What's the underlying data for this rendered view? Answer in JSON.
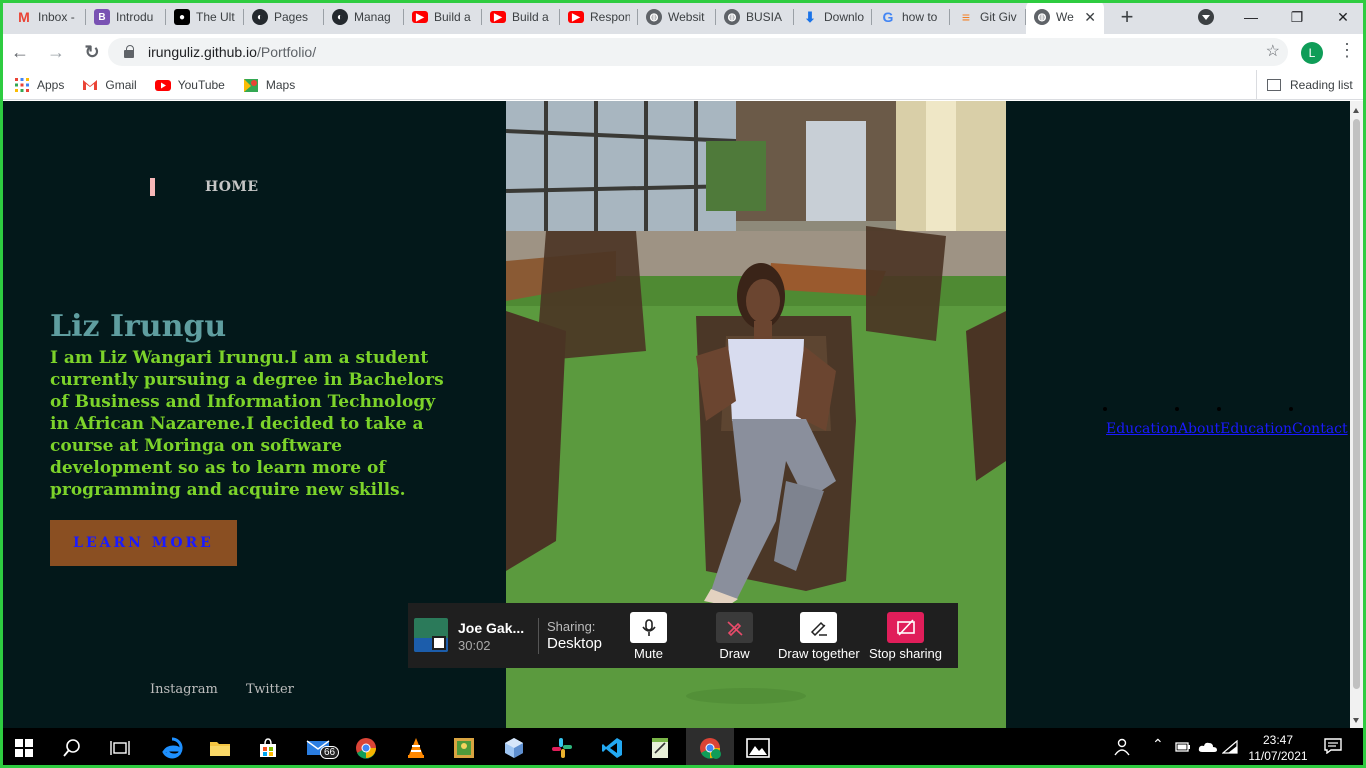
{
  "browser": {
    "tabs": [
      {
        "title": "Inbox -",
        "icon": "gmail-icon",
        "color": "#ea4335"
      },
      {
        "title": "Introdu",
        "icon": "bootstrap-icon",
        "color": "#7952b3"
      },
      {
        "title": "The Ult",
        "icon": "medium-icon",
        "color": "#000000"
      },
      {
        "title": "Pages",
        "icon": "github-icon",
        "color": "#24292e"
      },
      {
        "title": "Manag",
        "icon": "github-icon",
        "color": "#24292e"
      },
      {
        "title": "Build a",
        "icon": "youtube-icon",
        "color": "#ff0000"
      },
      {
        "title": "Build a",
        "icon": "youtube-icon",
        "color": "#ff0000"
      },
      {
        "title": "Respon",
        "icon": "youtube-icon",
        "color": "#ff0000"
      },
      {
        "title": "Websit",
        "icon": "globe-icon",
        "color": "#5f6368"
      },
      {
        "title": "BUSIA",
        "icon": "globe-icon",
        "color": "#5f6368"
      },
      {
        "title": "Downlo",
        "icon": "download-icon",
        "color": "#1a73e8"
      },
      {
        "title": "how to",
        "icon": "google-icon",
        "color": "#4285f4"
      },
      {
        "title": "Git Giv",
        "icon": "stackoverflow-icon",
        "color": "#f48024"
      },
      {
        "title": "We",
        "icon": "globe-icon",
        "color": "#5f6368",
        "active": true
      }
    ],
    "new_tab": "+",
    "url_host": "irunguliz.github.io",
    "url_path": "/Portfolio/",
    "profile_initial": "L",
    "bookmarks": [
      {
        "label": "Apps",
        "icon": "apps-grid-icon"
      },
      {
        "label": "Gmail",
        "icon": "gmail-icon"
      },
      {
        "label": "YouTube",
        "icon": "youtube-icon"
      },
      {
        "label": "Maps",
        "icon": "maps-icon"
      }
    ],
    "reading_list": "Reading list"
  },
  "page": {
    "nav_home": "HOME",
    "name": "Liz Irungu",
    "bio": "I am Liz Wangari Irungu.I am a student currently pursuing a degree in Bachelors of Business and Information Technology in African Nazarene.I decided to take a course at Moringa on software development so as to learn more of programming and acquire new skills.",
    "learn_more": "LEARN MORE",
    "social": {
      "instagram": "Instagram",
      "twitter": "Twitter"
    },
    "nav_links": [
      "Education",
      "About",
      "Education",
      "Contact"
    ],
    "colors": {
      "background": "#03181a",
      "name": "#5f9ea0",
      "bio": "#7cd32a",
      "button": "#8a4f22",
      "link": "#1a1aff"
    }
  },
  "share_bar": {
    "presenter": "Joe Gak...",
    "duration": "30:02",
    "sharing_label": "Sharing:",
    "sharing_value": "Desktop",
    "buttons": {
      "mute": "Mute",
      "draw": "Draw",
      "draw_together": "Draw together",
      "stop_sharing": "Stop sharing"
    }
  },
  "taskbar": {
    "mail_badge": "66",
    "time": "23:47",
    "date": "11/07/2021"
  }
}
